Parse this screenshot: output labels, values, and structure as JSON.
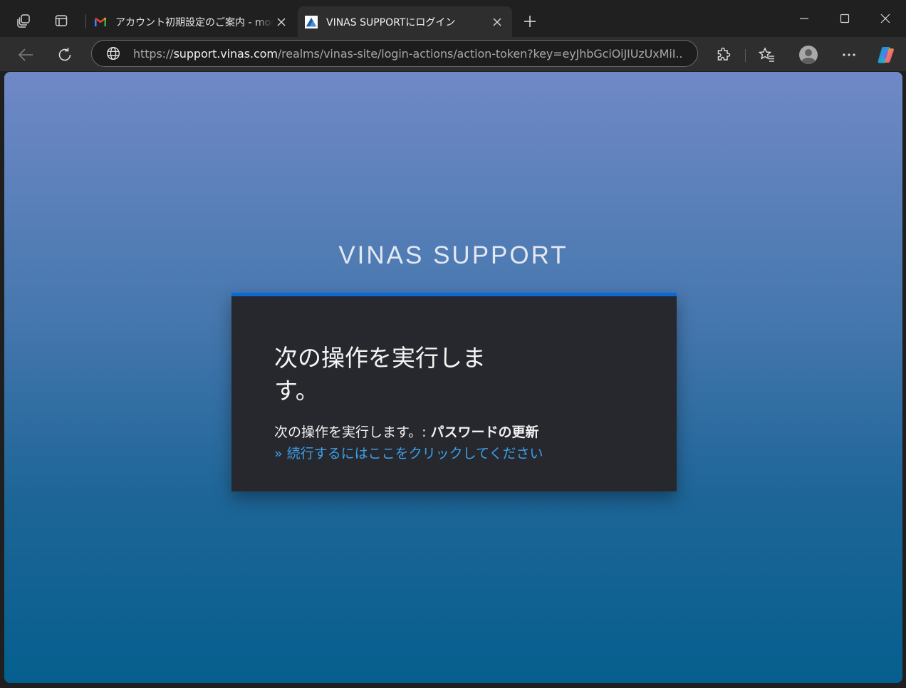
{
  "browser": {
    "tabs": [
      {
        "title": "アカウント初期設定のご案内 - morim",
        "favicon": "gmail-icon",
        "active": false
      },
      {
        "title": "VINAS SUPPORTにログイン",
        "favicon": "vinas-logo-icon",
        "active": true
      }
    ],
    "address": {
      "scheme": "https://",
      "host": "support.vinas.com",
      "path": "/realms/vinas-site/login-actions/action-token?key=eyJhbGciOiJIUzUxMiI..."
    }
  },
  "page": {
    "brand": "VINAS SUPPORT",
    "card": {
      "title": "次の操作を実行します。",
      "message_prefix": "次の操作を実行します。: ",
      "message_action": "パスワードの更新",
      "link_text": "» 続行するにはここをクリックしてください"
    }
  },
  "colors": {
    "accent_bar": "#0b6bd6",
    "link": "#3d9fe8",
    "card_bg": "#26282d",
    "bg_top": "#7089c6",
    "bg_bottom": "#055f8e"
  }
}
